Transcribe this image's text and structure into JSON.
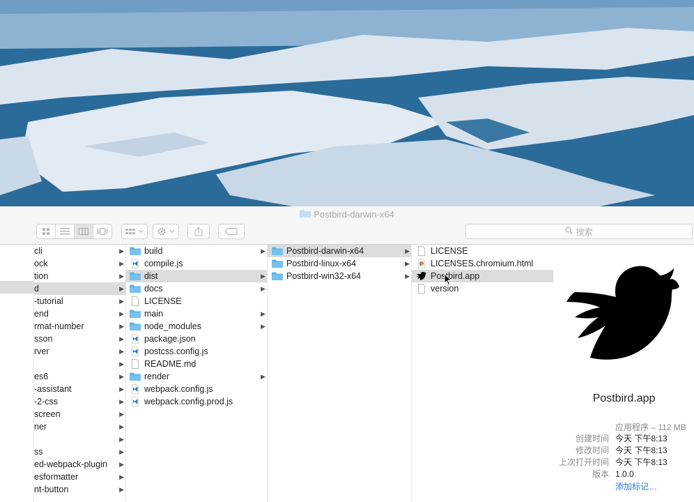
{
  "window": {
    "title": "Postbird-darwin-x64"
  },
  "toolbar": {
    "view_icons": [
      "icon-view-icon",
      "list-view-icon",
      "column-view-icon",
      "cover-flow-icon"
    ],
    "search_placeholder": "搜索"
  },
  "columns": {
    "col1": [
      {
        "label": "cli",
        "has_children": true,
        "selected": false
      },
      {
        "label": "ock",
        "has_children": true,
        "selected": false
      },
      {
        "label": "tion",
        "has_children": true,
        "selected": false
      },
      {
        "label": "d",
        "has_children": true,
        "selected": true
      },
      {
        "label": "-tutorial",
        "has_children": true,
        "selected": false
      },
      {
        "label": "end",
        "has_children": true,
        "selected": false
      },
      {
        "label": "rmat-number",
        "has_children": true,
        "selected": false
      },
      {
        "label": "sson",
        "has_children": true,
        "selected": false
      },
      {
        "label": "rver",
        "has_children": true,
        "selected": false
      },
      {
        "label": "",
        "has_children": true,
        "selected": false
      },
      {
        "label": "es6",
        "has_children": true,
        "selected": false
      },
      {
        "label": "-assistant",
        "has_children": true,
        "selected": false
      },
      {
        "label": "-2-css",
        "has_children": true,
        "selected": false
      },
      {
        "label": "screen",
        "has_children": true,
        "selected": false
      },
      {
        "label": "ner",
        "has_children": true,
        "selected": false
      },
      {
        "label": "",
        "has_children": true,
        "selected": false
      },
      {
        "label": "ss",
        "has_children": true,
        "selected": false
      },
      {
        "label": "ed-webpack-plugin",
        "has_children": true,
        "selected": false
      },
      {
        "label": "esformatter",
        "has_children": true,
        "selected": false
      },
      {
        "label": "nt-button",
        "has_children": true,
        "selected": false
      }
    ],
    "col2": [
      {
        "label": "build",
        "type": "folder",
        "has_children": true,
        "selected": false
      },
      {
        "label": "compile.js",
        "type": "vscode",
        "has_children": false,
        "selected": false
      },
      {
        "label": "dist",
        "type": "folder",
        "has_children": true,
        "selected": true
      },
      {
        "label": "docs",
        "type": "folder",
        "has_children": true,
        "selected": false
      },
      {
        "label": "LICENSE",
        "type": "file",
        "has_children": false,
        "selected": false
      },
      {
        "label": "main",
        "type": "folder",
        "has_children": true,
        "selected": false
      },
      {
        "label": "node_modules",
        "type": "folder",
        "has_children": true,
        "selected": false
      },
      {
        "label": "package.json",
        "type": "vscode",
        "has_children": false,
        "selected": false
      },
      {
        "label": "postcss.config.js",
        "type": "vscode",
        "has_children": false,
        "selected": false
      },
      {
        "label": "README.md",
        "type": "file",
        "has_children": false,
        "selected": false
      },
      {
        "label": "render",
        "type": "folder",
        "has_children": true,
        "selected": false
      },
      {
        "label": "webpack.config.js",
        "type": "vscode",
        "has_children": false,
        "selected": false
      },
      {
        "label": "webpack.config.prod.js",
        "type": "vscode",
        "has_children": false,
        "selected": false
      }
    ],
    "col3": [
      {
        "label": "Postbird-darwin-x64",
        "type": "folder",
        "has_children": true,
        "selected": true
      },
      {
        "label": "Postbird-linux-x64",
        "type": "folder",
        "has_children": true,
        "selected": false
      },
      {
        "label": "Postbird-win32-x64",
        "type": "folder",
        "has_children": true,
        "selected": false
      }
    ],
    "col4": [
      {
        "label": "LICENSE",
        "type": "file",
        "has_children": false,
        "selected": false
      },
      {
        "label": "LICENSES.chromium.html",
        "type": "chrome",
        "has_children": false,
        "selected": false
      },
      {
        "label": "Postbird.app",
        "type": "bird",
        "has_children": false,
        "selected": true
      },
      {
        "label": "version",
        "type": "file",
        "has_children": false,
        "selected": false
      }
    ]
  },
  "preview": {
    "name": "Postbird.app",
    "kind": "应用程序 – 112 MB",
    "info": [
      {
        "label": "创建时间",
        "value": "今天 下午8:13"
      },
      {
        "label": "修改时间",
        "value": "今天 下午8:13"
      },
      {
        "label": "上次打开时间",
        "value": "今天 下午8:13"
      },
      {
        "label": "版本",
        "value": "1.0.0"
      }
    ],
    "add_tags": "添加标记…"
  },
  "colors": {
    "folder": "#5eb3e8",
    "selection": "#dcdcdc",
    "link": "#2a7ae2",
    "wallpaper_water": "#2a6a98",
    "wallpaper_ice": "#dde6f0"
  }
}
